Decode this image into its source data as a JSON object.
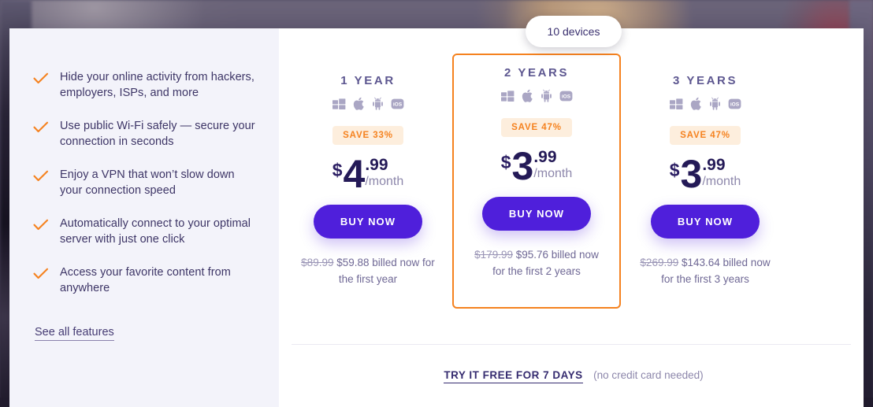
{
  "devices_pill": {
    "label": "10 devices"
  },
  "features": {
    "items": [
      "Hide your online activity from hackers, employers, ISPs, and more",
      "Use public Wi-Fi safely — secure your connection in seconds",
      "Enjoy a VPN that won’t slow down your connection speed",
      "Automatically connect to your optimal server with just one click",
      "Access your favorite content from anywhere"
    ],
    "see_all_label": "See all features",
    "check_color": "#f5821f",
    "panel_bg": "#f3f3fa"
  },
  "plans": [
    {
      "title": "1 YEAR",
      "platforms": [
        "windows-icon",
        "apple-icon",
        "android-icon",
        "ios-icon"
      ],
      "save_badge": "SAVE 33%",
      "currency": "$",
      "amount": "4",
      "cents": ".99",
      "per": "/month",
      "buy_label": "BUY NOW",
      "old_price": "$89.99",
      "billed_text": " $59.88 billed now for the first year",
      "featured": false
    },
    {
      "title": "2 YEARS",
      "platforms": [
        "windows-icon",
        "apple-icon",
        "android-icon",
        "ios-icon"
      ],
      "save_badge": "SAVE 47%",
      "currency": "$",
      "amount": "3",
      "cents": ".99",
      "per": "/month",
      "buy_label": "BUY NOW",
      "old_price": "$179.99",
      "billed_text": " $95.76 billed now for the first 2 years",
      "featured": true
    },
    {
      "title": "3 YEARS",
      "platforms": [
        "windows-icon",
        "apple-icon",
        "android-icon",
        "ios-icon"
      ],
      "save_badge": "SAVE 47%",
      "currency": "$",
      "amount": "3",
      "cents": ".99",
      "per": "/month",
      "buy_label": "BUY NOW",
      "old_price": "$269.99",
      "billed_text": " $143.64 billed now for the first 3 years",
      "featured": false
    }
  ],
  "trial": {
    "link_label": "TRY IT FREE FOR 7 DAYS",
    "note": "(no credit card needed)"
  },
  "colors": {
    "accent_orange": "#f5821f",
    "buy_purple": "#4f1fdb",
    "heading_purple": "#5d5790",
    "price_navy": "#241a57",
    "muted": "#8d87ab",
    "badge_bg": "#fdeedd"
  }
}
